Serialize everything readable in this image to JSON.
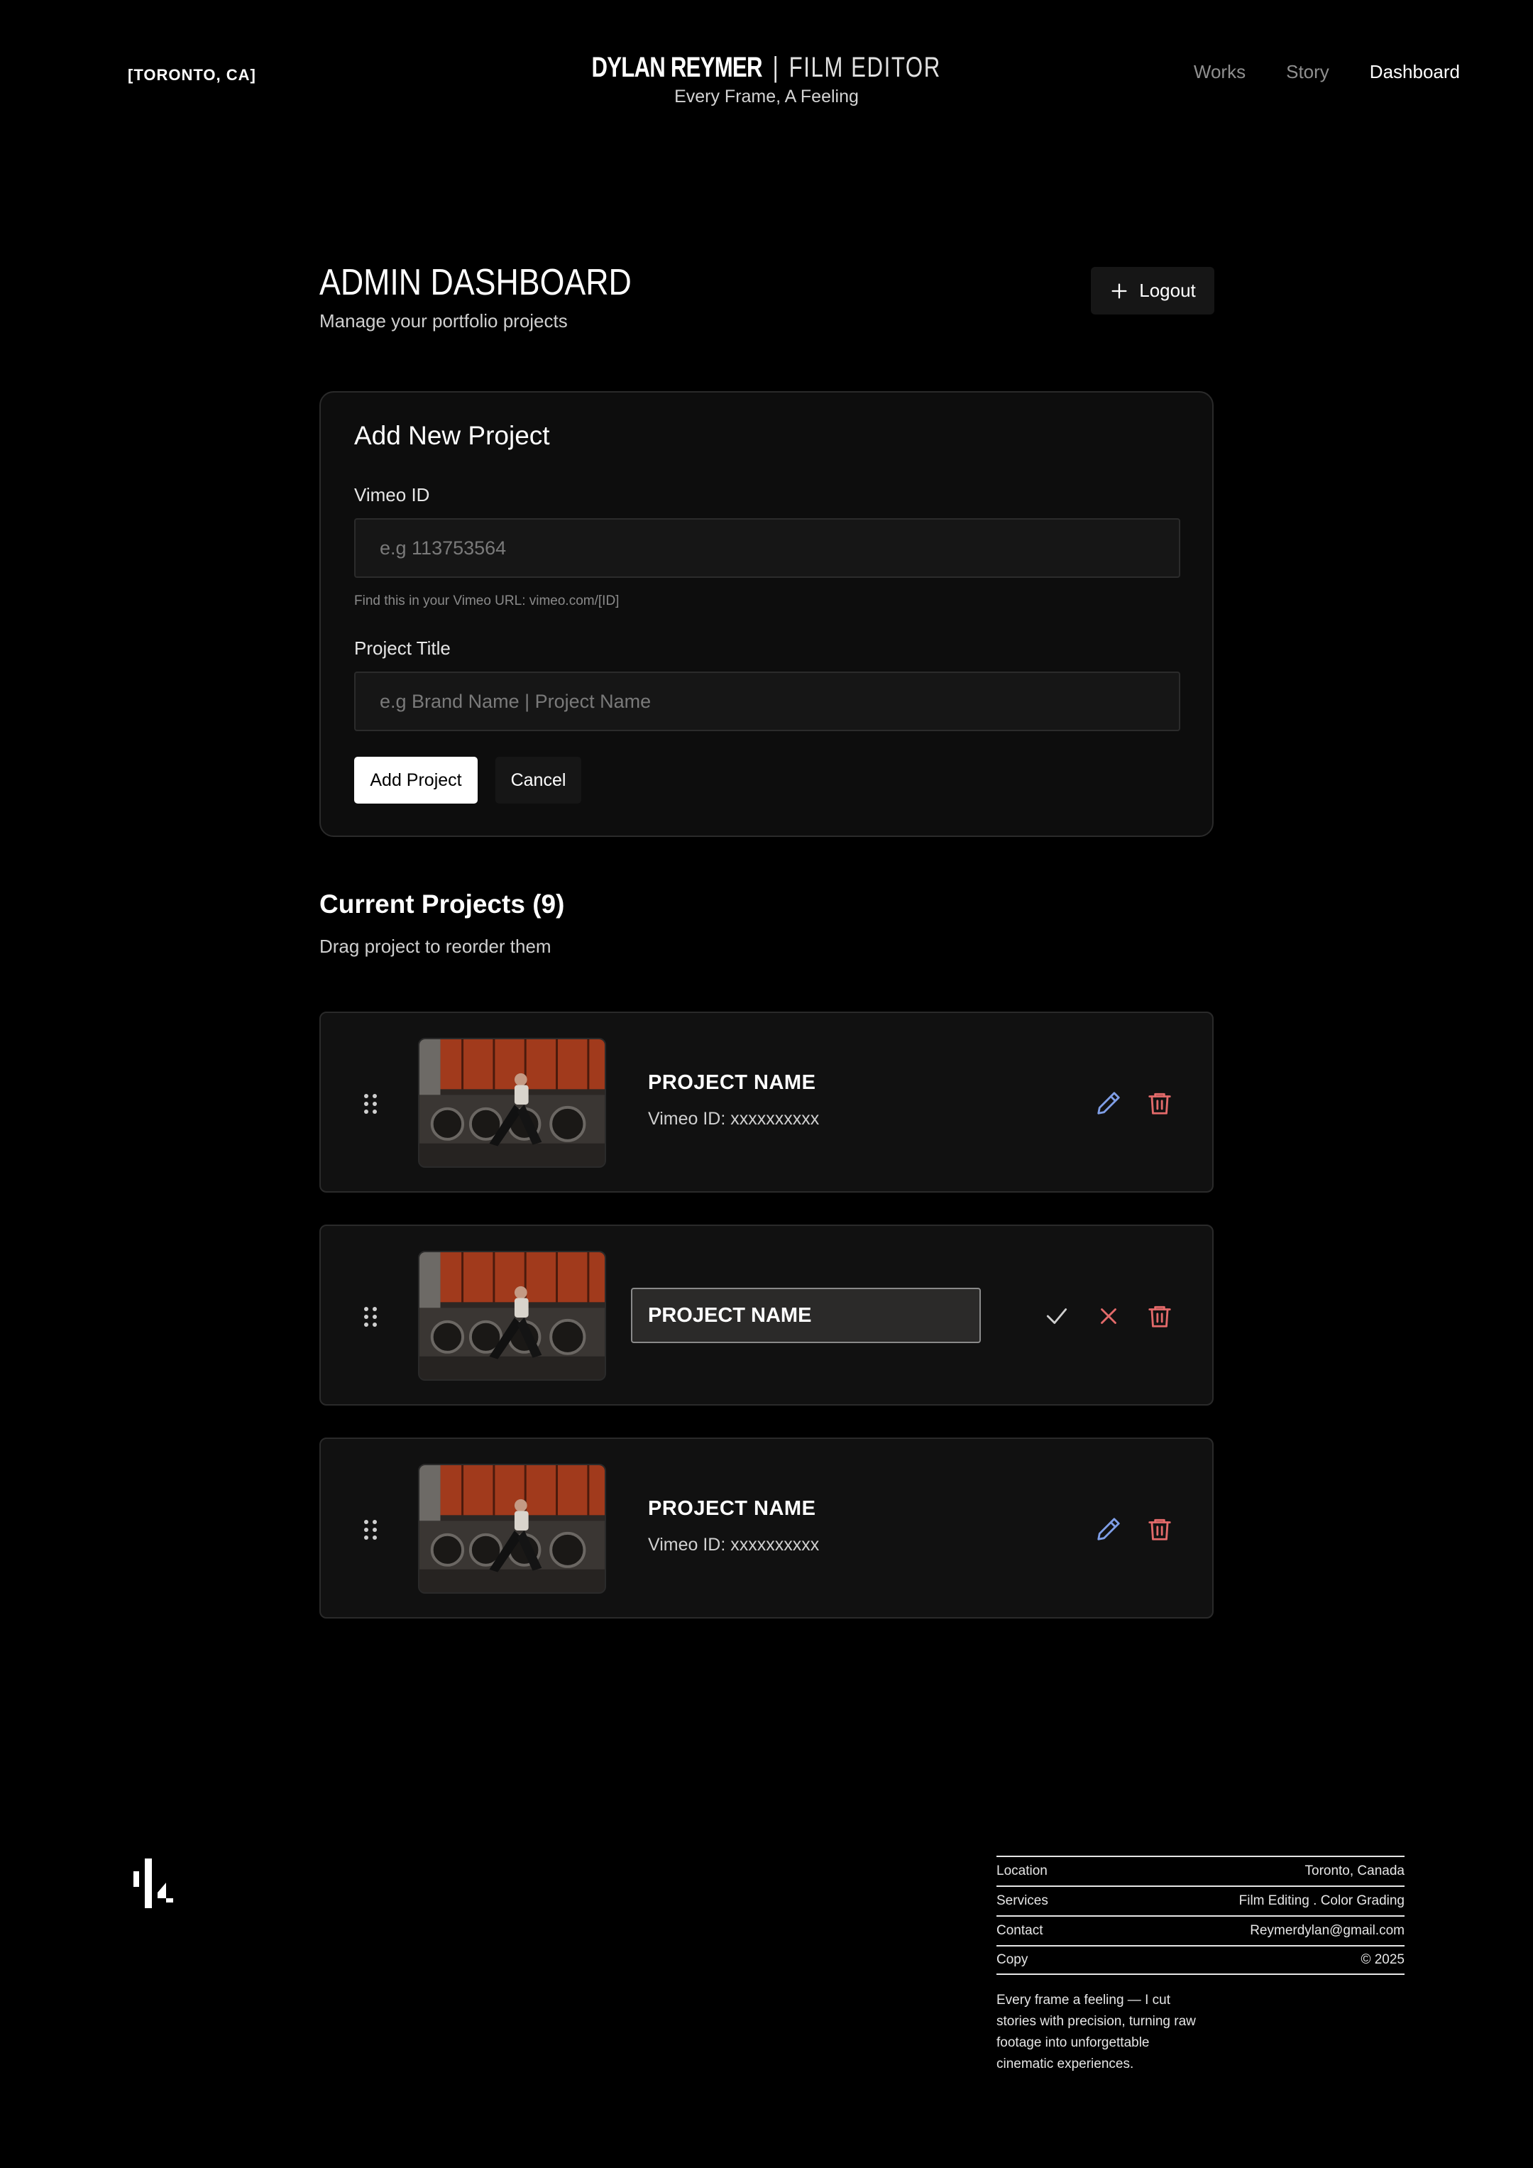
{
  "header": {
    "location": "[TORONTO, CA]",
    "brand_name": "DYLAN REYMER",
    "brand_separator": "|",
    "brand_role": "FILM EDITOR",
    "tagline": "Every Frame, A Feeling",
    "nav": [
      {
        "label": "Works",
        "active": false
      },
      {
        "label": "Story",
        "active": false
      },
      {
        "label": "Dashboard",
        "active": true
      }
    ]
  },
  "page": {
    "title": "ADMIN DASHBOARD",
    "subtitle": "Manage your portfolio projects",
    "logout_label": "Logout",
    "logout_icon": "plus-icon"
  },
  "add_form": {
    "title": "Add New Project",
    "vimeo_label": "Vimeo ID",
    "vimeo_placeholder": "e.g 113753564",
    "vimeo_hint": "Find this in your Vimeo URL: vimeo.com/[ID]",
    "title_label": "Project Title",
    "title_placeholder": "e.g Brand Name | Project Name",
    "add_label": "Add Project",
    "cancel_label": "Cancel"
  },
  "projects": {
    "heading": "Current Projects (9)",
    "subtitle": "Drag project to reorder them",
    "items": [
      {
        "name": "PROJECT NAME",
        "vimeo": "Vimeo ID: xxxxxxxxxx",
        "editing": false
      },
      {
        "name": "PROJECT NAME",
        "vimeo": "",
        "editing": true
      },
      {
        "name": "PROJECT NAME",
        "vimeo": "Vimeo ID: xxxxxxxxxx",
        "editing": false
      }
    ]
  },
  "colors": {
    "edit_icon": "#7f9ee6",
    "delete_icon": "#e36a6a",
    "cancel_icon": "#e36a6a",
    "confirm_icon": "#cfcfcf"
  },
  "footer": {
    "rows": [
      {
        "key": "Location",
        "value": "Toronto, Canada"
      },
      {
        "key": "Services",
        "value": "Film Editing . Color Grading"
      },
      {
        "key": "Contact",
        "value": "Reymerdylan@gmail.com"
      },
      {
        "key": "Copy",
        "value": "© 2025"
      }
    ],
    "blurb": "Every frame a feeling — I cut stories with precision, turning raw footage into unforgettable cinematic experiences."
  }
}
